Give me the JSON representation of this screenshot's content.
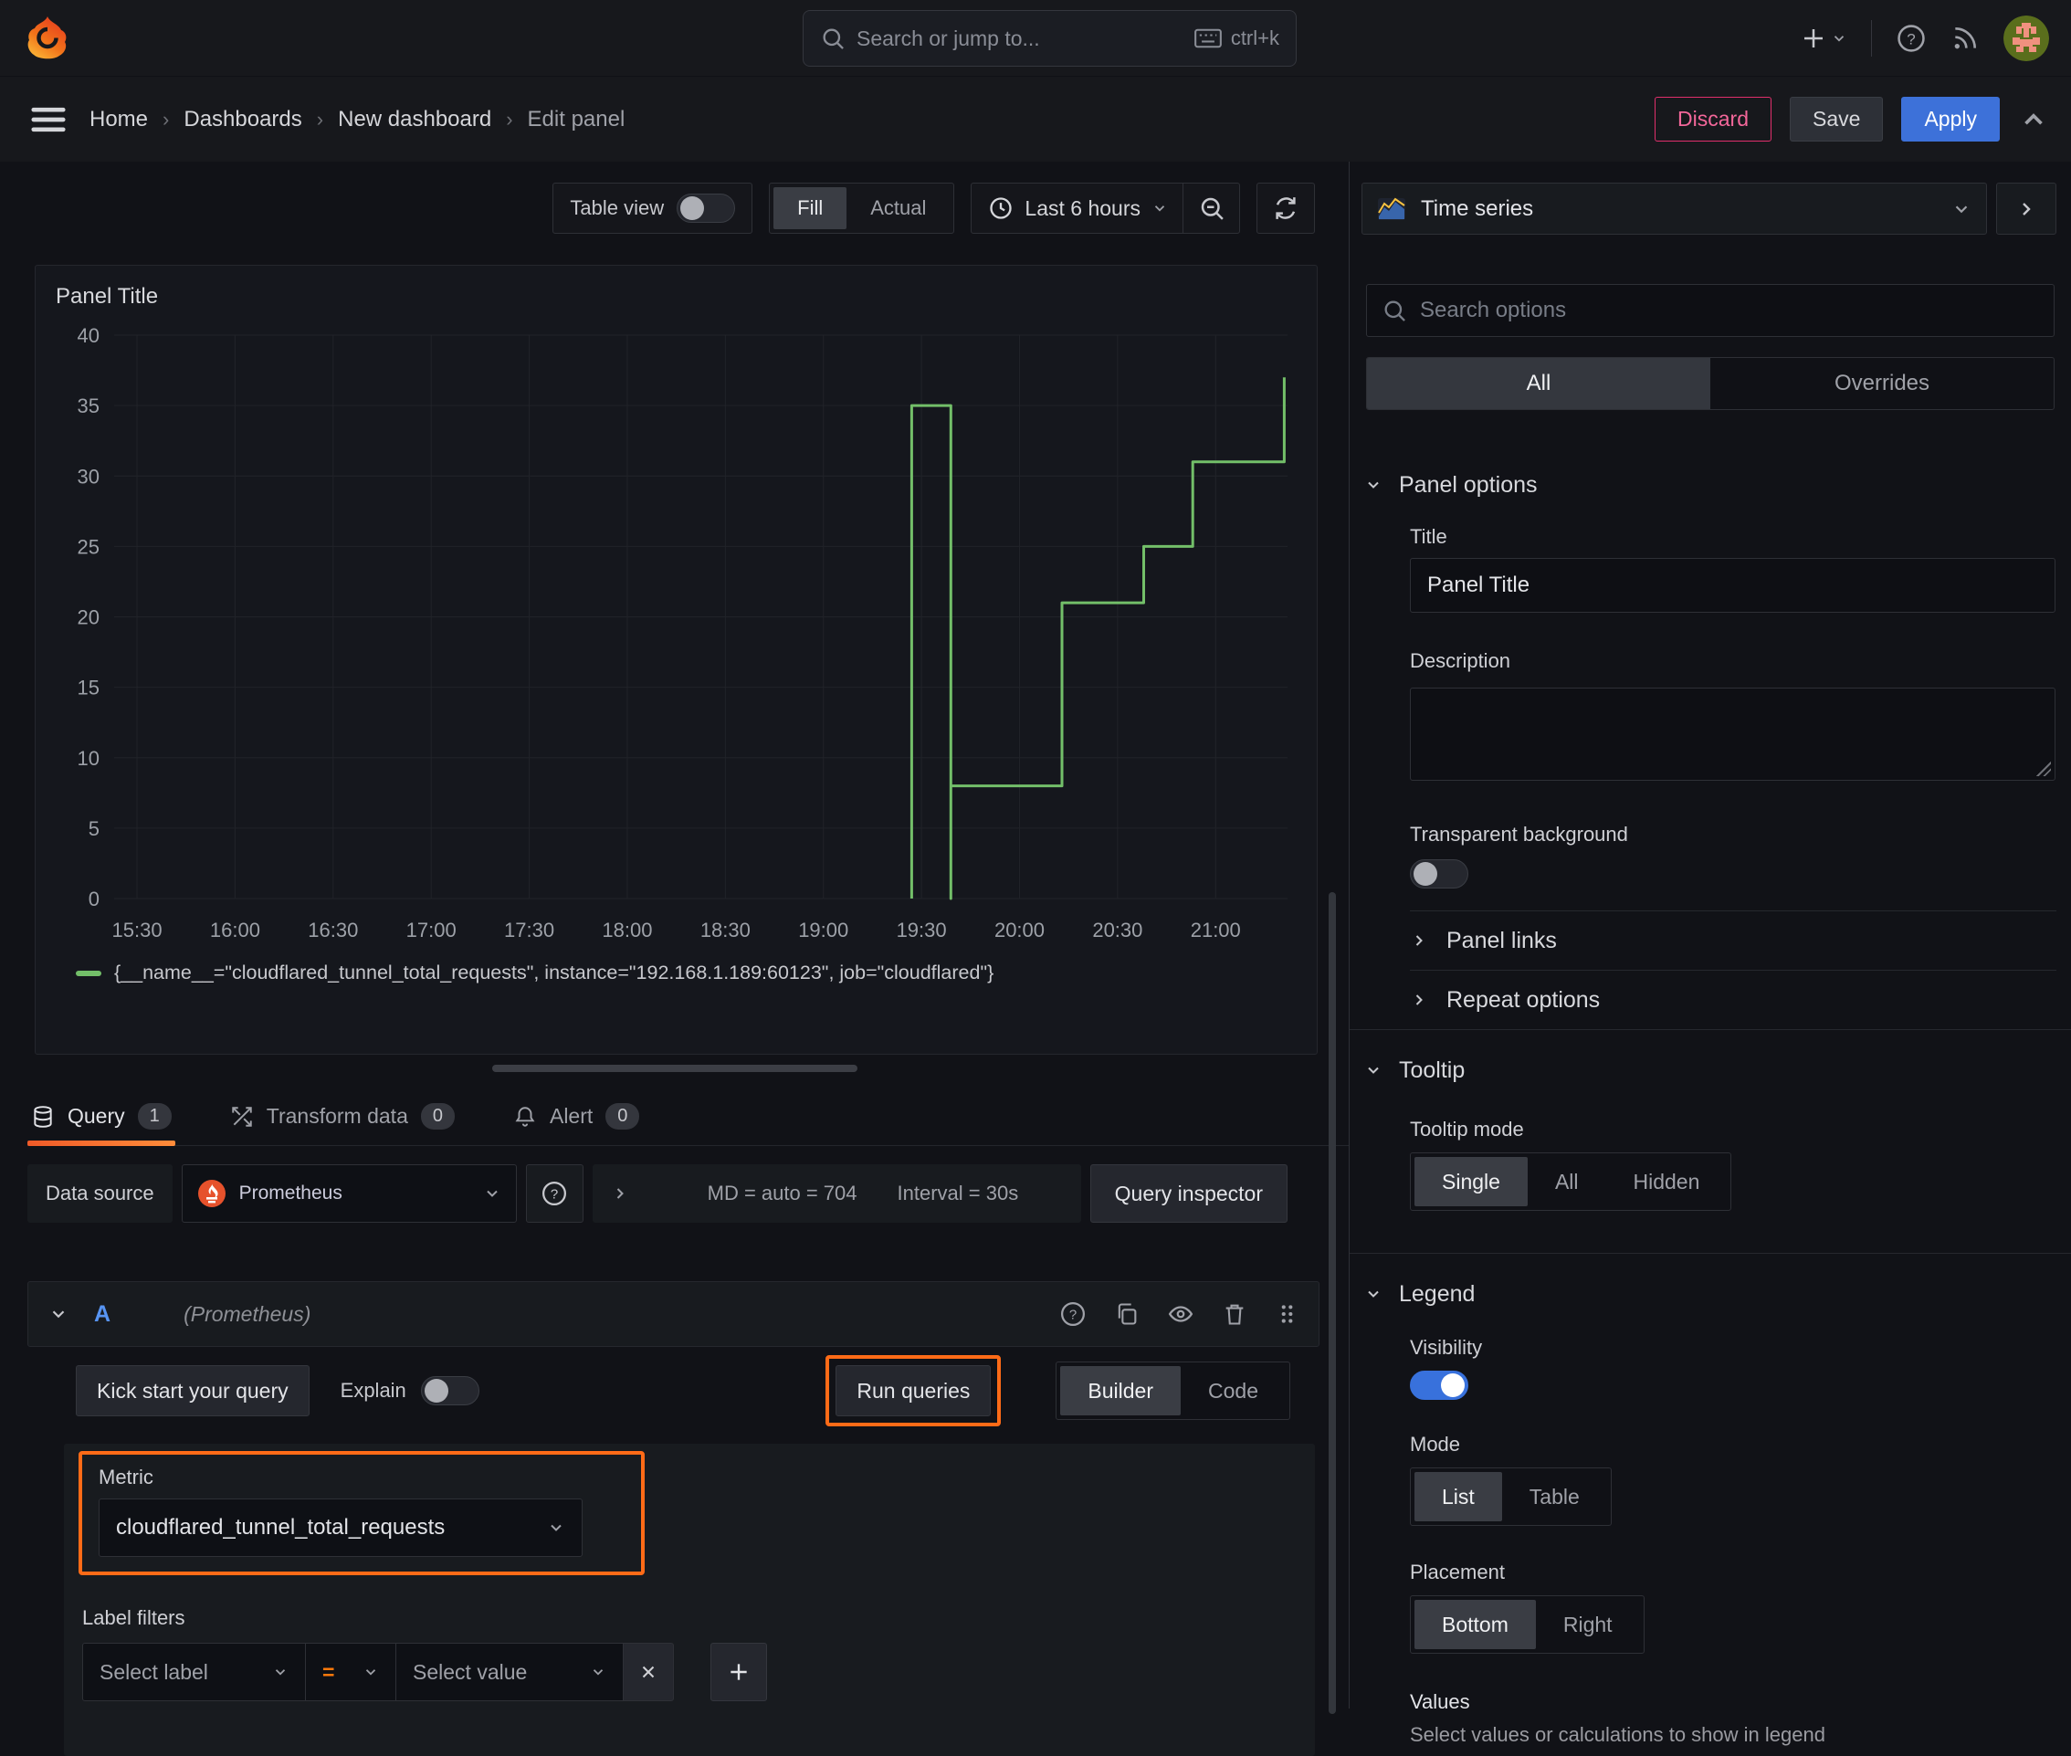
{
  "topbar": {
    "search_placeholder": "Search or jump to...",
    "shortcut": "ctrl+k"
  },
  "breadcrumb": {
    "separator": "›",
    "items": [
      "Home",
      "Dashboards",
      "New dashboard",
      "Edit panel"
    ],
    "discard_label": "Discard",
    "save_label": "Save",
    "apply_label": "Apply"
  },
  "toolbar": {
    "table_view_label": "Table view",
    "fill_label": "Fill",
    "actual_label": "Actual",
    "time_range_label": "Last 6 hours"
  },
  "panel": {
    "title": "Panel Title",
    "legend_label": "{__name__=\"cloudflared_tunnel_total_requests\", instance=\"192.168.1.189:60123\", job=\"cloudflared\"}"
  },
  "chart_data": {
    "type": "line",
    "line_style": "step",
    "title": "Panel Title",
    "x_range": [
      "15:23",
      "21:22"
    ],
    "x_ticks": [
      "15:30",
      "16:00",
      "16:30",
      "17:00",
      "17:30",
      "18:00",
      "18:30",
      "19:00",
      "19:30",
      "20:00",
      "20:30",
      "21:00"
    ],
    "y_ticks": [
      0,
      5,
      10,
      15,
      20,
      25,
      30,
      35,
      40
    ],
    "ylim": [
      0,
      40
    ],
    "grid": true,
    "legend_position": "bottom",
    "series": [
      {
        "name": "{__name__=\"cloudflared_tunnel_total_requests\", instance=\"192.168.1.189:60123\", job=\"cloudflared\"}",
        "color": "#73bf69",
        "points": [
          [
            "19:27",
            0
          ],
          [
            "19:27",
            35
          ],
          [
            "19:39",
            35
          ],
          [
            "19:39",
            0
          ],
          [
            "19:39",
            8
          ],
          [
            "20:13",
            8
          ],
          [
            "20:13",
            21
          ],
          [
            "20:38",
            21
          ],
          [
            "20:38",
            25
          ],
          [
            "20:53",
            25
          ],
          [
            "20:53",
            31
          ],
          [
            "21:21",
            31
          ],
          [
            "21:21",
            37
          ]
        ]
      }
    ]
  },
  "tabs": {
    "query_label": "Query",
    "query_count": "1",
    "transform_label": "Transform data",
    "transform_count": "0",
    "alert_label": "Alert",
    "alert_count": "0"
  },
  "datasource_row": {
    "label": "Data source",
    "value": "Prometheus",
    "stats_md": "MD = auto = 704",
    "stats_interval": "Interval = 30s",
    "inspector_label": "Query inspector"
  },
  "query_editor": {
    "ref_id": "A",
    "ds_hint": "(Prometheus)",
    "kick_start_label": "Kick start your query",
    "explain_label": "Explain",
    "run_queries_label": "Run queries",
    "builder_label": "Builder",
    "code_label": "Code",
    "metric_label": "Metric",
    "metric_value": "cloudflared_tunnel_total_requests",
    "label_filters_label": "Label filters",
    "select_label_placeholder": "Select label",
    "operator": "=",
    "select_value_placeholder": "Select value"
  },
  "options_panel": {
    "viz_type": "Time series",
    "search_placeholder": "Search options",
    "tab_all": "All",
    "tab_overrides": "Overrides",
    "panel_options": {
      "heading": "Panel options",
      "title_label": "Title",
      "title_value": "Panel Title",
      "description_label": "Description",
      "transparent_label": "Transparent background"
    },
    "panel_links_label": "Panel links",
    "repeat_options_label": "Repeat options",
    "tooltip": {
      "heading": "Tooltip",
      "mode_label": "Tooltip mode",
      "options": [
        "Single",
        "All",
        "Hidden"
      ],
      "selected": "Single"
    },
    "legend": {
      "heading": "Legend",
      "visibility_label": "Visibility",
      "mode_label": "Mode",
      "mode_options": [
        "List",
        "Table"
      ],
      "mode_selected": "List",
      "placement_label": "Placement",
      "placement_options": [
        "Bottom",
        "Right"
      ],
      "placement_selected": "Bottom",
      "values_label": "Values",
      "values_hint": "Select values or calculations to show in legend"
    }
  },
  "colors": {
    "accent_orange": "#ff780a",
    "annotation_orange": "#ff6b17",
    "series_green": "#73bf69",
    "apply_blue": "#3d71d9",
    "discard_pink": "#e02f6c",
    "toggle_blue": "#3871dc"
  }
}
